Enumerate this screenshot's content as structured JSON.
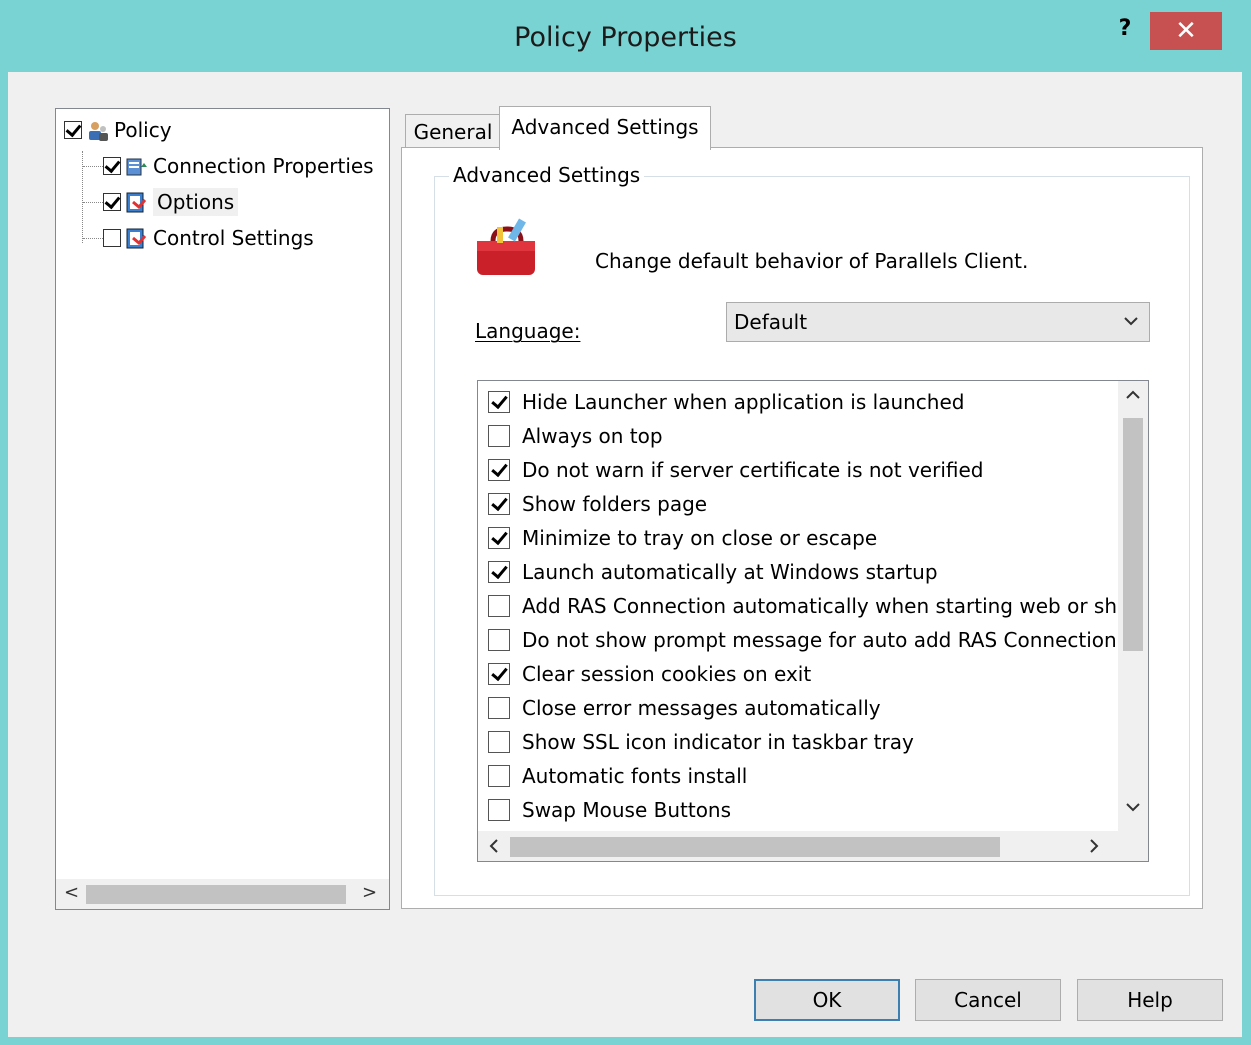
{
  "window": {
    "title": "Policy Properties",
    "help_glyph": "?",
    "close_glyph": "✕"
  },
  "tree": {
    "items": [
      {
        "label": "Policy",
        "checked": true,
        "icon": "policy-user-icon"
      },
      {
        "label": "Connection Properties",
        "checked": true,
        "icon": "connection-properties-icon"
      },
      {
        "label": "Options",
        "checked": true,
        "icon": "options-icon",
        "selected": true
      },
      {
        "label": "Control Settings",
        "checked": false,
        "icon": "control-settings-icon"
      }
    ],
    "scroll_left": "<",
    "scroll_right": ">"
  },
  "tabs": [
    {
      "label": "General",
      "active": false
    },
    {
      "label": "Advanced Settings",
      "active": true
    }
  ],
  "advanced": {
    "group_label": "Advanced Settings",
    "description": "Change default behavior of Parallels Client.",
    "language_label": "Language:",
    "language_value": "Default",
    "options": [
      {
        "label": "Hide Launcher when application is launched",
        "checked": true
      },
      {
        "label": "Always on top",
        "checked": false
      },
      {
        "label": "Do not warn if server certificate is not verified",
        "checked": true
      },
      {
        "label": "Show folders page",
        "checked": true
      },
      {
        "label": "Minimize to tray on close or escape",
        "checked": true
      },
      {
        "label": "Launch automatically at Windows startup",
        "checked": true
      },
      {
        "label": "Add RAS Connection automatically when starting web or shor",
        "checked": false
      },
      {
        "label": "Do not show prompt message for auto add RAS Connection",
        "checked": false
      },
      {
        "label": "Clear session cookies on exit",
        "checked": true
      },
      {
        "label": "Close error messages automatically",
        "checked": false
      },
      {
        "label": "Show SSL icon indicator in taskbar tray",
        "checked": false
      },
      {
        "label": "Automatic fonts install",
        "checked": false
      },
      {
        "label": "Swap Mouse Buttons",
        "checked": false
      }
    ]
  },
  "buttons": {
    "ok": "OK",
    "cancel": "Cancel",
    "help": "Help"
  },
  "colors": {
    "titlebar": "#7ad3d3",
    "close": "#c75050",
    "default_border": "#3c7fb1"
  }
}
